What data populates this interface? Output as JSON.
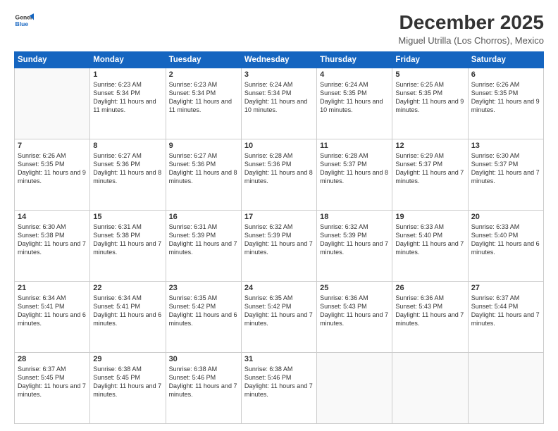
{
  "header": {
    "logo_line1": "General",
    "logo_line2": "Blue",
    "month": "December 2025",
    "location": "Miguel Utrilla (Los Chorros), Mexico"
  },
  "days_of_week": [
    "Sunday",
    "Monday",
    "Tuesday",
    "Wednesday",
    "Thursday",
    "Friday",
    "Saturday"
  ],
  "weeks": [
    [
      {
        "day": "",
        "sunrise": "",
        "sunset": "",
        "daylight": ""
      },
      {
        "day": "1",
        "sunrise": "Sunrise: 6:23 AM",
        "sunset": "Sunset: 5:34 PM",
        "daylight": "Daylight: 11 hours and 11 minutes."
      },
      {
        "day": "2",
        "sunrise": "Sunrise: 6:23 AM",
        "sunset": "Sunset: 5:34 PM",
        "daylight": "Daylight: 11 hours and 11 minutes."
      },
      {
        "day": "3",
        "sunrise": "Sunrise: 6:24 AM",
        "sunset": "Sunset: 5:34 PM",
        "daylight": "Daylight: 11 hours and 10 minutes."
      },
      {
        "day": "4",
        "sunrise": "Sunrise: 6:24 AM",
        "sunset": "Sunset: 5:35 PM",
        "daylight": "Daylight: 11 hours and 10 minutes."
      },
      {
        "day": "5",
        "sunrise": "Sunrise: 6:25 AM",
        "sunset": "Sunset: 5:35 PM",
        "daylight": "Daylight: 11 hours and 9 minutes."
      },
      {
        "day": "6",
        "sunrise": "Sunrise: 6:26 AM",
        "sunset": "Sunset: 5:35 PM",
        "daylight": "Daylight: 11 hours and 9 minutes."
      }
    ],
    [
      {
        "day": "7",
        "sunrise": "Sunrise: 6:26 AM",
        "sunset": "Sunset: 5:35 PM",
        "daylight": "Daylight: 11 hours and 9 minutes."
      },
      {
        "day": "8",
        "sunrise": "Sunrise: 6:27 AM",
        "sunset": "Sunset: 5:36 PM",
        "daylight": "Daylight: 11 hours and 8 minutes."
      },
      {
        "day": "9",
        "sunrise": "Sunrise: 6:27 AM",
        "sunset": "Sunset: 5:36 PM",
        "daylight": "Daylight: 11 hours and 8 minutes."
      },
      {
        "day": "10",
        "sunrise": "Sunrise: 6:28 AM",
        "sunset": "Sunset: 5:36 PM",
        "daylight": "Daylight: 11 hours and 8 minutes."
      },
      {
        "day": "11",
        "sunrise": "Sunrise: 6:28 AM",
        "sunset": "Sunset: 5:37 PM",
        "daylight": "Daylight: 11 hours and 8 minutes."
      },
      {
        "day": "12",
        "sunrise": "Sunrise: 6:29 AM",
        "sunset": "Sunset: 5:37 PM",
        "daylight": "Daylight: 11 hours and 7 minutes."
      },
      {
        "day": "13",
        "sunrise": "Sunrise: 6:30 AM",
        "sunset": "Sunset: 5:37 PM",
        "daylight": "Daylight: 11 hours and 7 minutes."
      }
    ],
    [
      {
        "day": "14",
        "sunrise": "Sunrise: 6:30 AM",
        "sunset": "Sunset: 5:38 PM",
        "daylight": "Daylight: 11 hours and 7 minutes."
      },
      {
        "day": "15",
        "sunrise": "Sunrise: 6:31 AM",
        "sunset": "Sunset: 5:38 PM",
        "daylight": "Daylight: 11 hours and 7 minutes."
      },
      {
        "day": "16",
        "sunrise": "Sunrise: 6:31 AM",
        "sunset": "Sunset: 5:39 PM",
        "daylight": "Daylight: 11 hours and 7 minutes."
      },
      {
        "day": "17",
        "sunrise": "Sunrise: 6:32 AM",
        "sunset": "Sunset: 5:39 PM",
        "daylight": "Daylight: 11 hours and 7 minutes."
      },
      {
        "day": "18",
        "sunrise": "Sunrise: 6:32 AM",
        "sunset": "Sunset: 5:39 PM",
        "daylight": "Daylight: 11 hours and 7 minutes."
      },
      {
        "day": "19",
        "sunrise": "Sunrise: 6:33 AM",
        "sunset": "Sunset: 5:40 PM",
        "daylight": "Daylight: 11 hours and 7 minutes."
      },
      {
        "day": "20",
        "sunrise": "Sunrise: 6:33 AM",
        "sunset": "Sunset: 5:40 PM",
        "daylight": "Daylight: 11 hours and 6 minutes."
      }
    ],
    [
      {
        "day": "21",
        "sunrise": "Sunrise: 6:34 AM",
        "sunset": "Sunset: 5:41 PM",
        "daylight": "Daylight: 11 hours and 6 minutes."
      },
      {
        "day": "22",
        "sunrise": "Sunrise: 6:34 AM",
        "sunset": "Sunset: 5:41 PM",
        "daylight": "Daylight: 11 hours and 6 minutes."
      },
      {
        "day": "23",
        "sunrise": "Sunrise: 6:35 AM",
        "sunset": "Sunset: 5:42 PM",
        "daylight": "Daylight: 11 hours and 6 minutes."
      },
      {
        "day": "24",
        "sunrise": "Sunrise: 6:35 AM",
        "sunset": "Sunset: 5:42 PM",
        "daylight": "Daylight: 11 hours and 7 minutes."
      },
      {
        "day": "25",
        "sunrise": "Sunrise: 6:36 AM",
        "sunset": "Sunset: 5:43 PM",
        "daylight": "Daylight: 11 hours and 7 minutes."
      },
      {
        "day": "26",
        "sunrise": "Sunrise: 6:36 AM",
        "sunset": "Sunset: 5:43 PM",
        "daylight": "Daylight: 11 hours and 7 minutes."
      },
      {
        "day": "27",
        "sunrise": "Sunrise: 6:37 AM",
        "sunset": "Sunset: 5:44 PM",
        "daylight": "Daylight: 11 hours and 7 minutes."
      }
    ],
    [
      {
        "day": "28",
        "sunrise": "Sunrise: 6:37 AM",
        "sunset": "Sunset: 5:45 PM",
        "daylight": "Daylight: 11 hours and 7 minutes."
      },
      {
        "day": "29",
        "sunrise": "Sunrise: 6:38 AM",
        "sunset": "Sunset: 5:45 PM",
        "daylight": "Daylight: 11 hours and 7 minutes."
      },
      {
        "day": "30",
        "sunrise": "Sunrise: 6:38 AM",
        "sunset": "Sunset: 5:46 PM",
        "daylight": "Daylight: 11 hours and 7 minutes."
      },
      {
        "day": "31",
        "sunrise": "Sunrise: 6:38 AM",
        "sunset": "Sunset: 5:46 PM",
        "daylight": "Daylight: 11 hours and 7 minutes."
      },
      {
        "day": "",
        "sunrise": "",
        "sunset": "",
        "daylight": ""
      },
      {
        "day": "",
        "sunrise": "",
        "sunset": "",
        "daylight": ""
      },
      {
        "day": "",
        "sunrise": "",
        "sunset": "",
        "daylight": ""
      }
    ]
  ]
}
